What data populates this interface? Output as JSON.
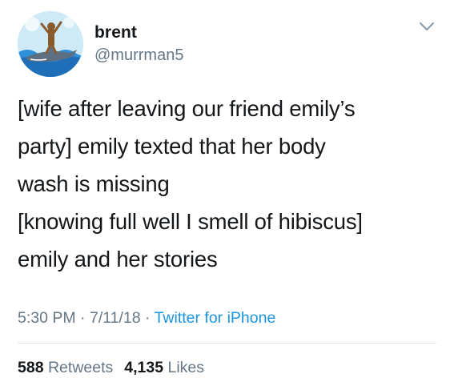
{
  "user": {
    "display_name": "brent",
    "handle": "@murrman5"
  },
  "tweet": {
    "lines": [
      "[wife after leaving our friend emily’s",
      "party] emily texted that her body",
      "wash is missing",
      "[knowing full well I smell of hibiscus]",
      "emily and her stories"
    ],
    "time": "5:30 PM",
    "separator": " · ",
    "date": "7/11/18",
    "source": "Twitter for iPhone"
  },
  "stats": {
    "retweets_count": "588",
    "retweets_label": "Retweets",
    "likes_count": "4,135",
    "likes_label": "Likes"
  },
  "icons": {
    "avatar": "avatar-image",
    "menu": "chevron-down-icon"
  },
  "colors": {
    "text": "#14171a",
    "secondary": "#657786",
    "link": "#1b95e0",
    "divider": "#e1e8ed"
  }
}
